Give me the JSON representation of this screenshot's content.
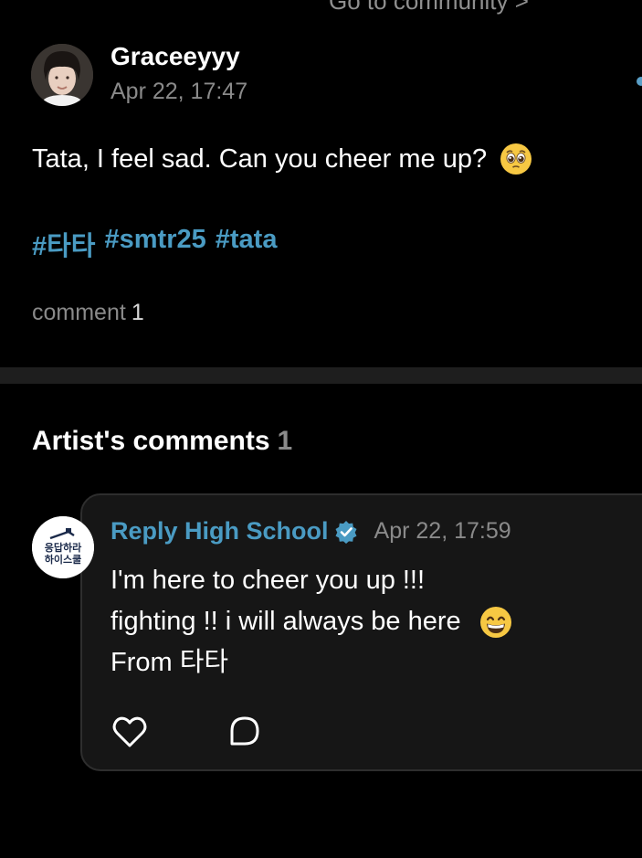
{
  "top_cutoff_text": "Go to community >",
  "post": {
    "author": "Graceeyyy",
    "timestamp": "Apr 22, 17:47",
    "text": "Tata, I feel sad. Can you cheer me up?",
    "text_emoji": "pleading-face",
    "hashtags": [
      "#타타",
      "#smtr25",
      "#tata"
    ],
    "comment_label": "comment",
    "comment_count": "1"
  },
  "artist_comments": {
    "title": "Artist's comments",
    "count": "1",
    "reply": {
      "author": "Reply High School",
      "verified": true,
      "timestamp": "Apr 22, 17:59",
      "lines": [
        "I'm here to cheer you up !!!",
        "fighting !! i will always be here",
        "From 타타"
      ],
      "line2_emoji": "grinning-face",
      "avatar_logo_text": [
        "응답하라",
        "하이스쿨"
      ]
    },
    "actions": {
      "like_icon": "heart-icon",
      "reply_icon": "comment-bubble-icon"
    }
  },
  "colors": {
    "background": "#000000",
    "accent_blue": "#4a9bc3",
    "muted_gray": "#8a8a8a",
    "card_background": "#161616",
    "divider": "#1e1e1e"
  }
}
